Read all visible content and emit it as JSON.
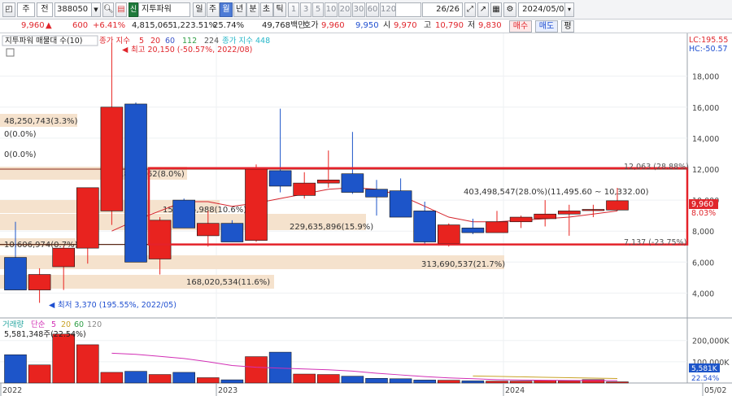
{
  "toolbar": {
    "market": "주",
    "scope": "전",
    "code": "388050",
    "stock_name": "지투파워",
    "period_tabs": [
      "일",
      "주",
      "월",
      "년",
      "분",
      "초",
      "틱"
    ],
    "active_period": "월",
    "intervals": [
      "1",
      "3",
      "5",
      "10",
      "20",
      "30",
      "60",
      "120"
    ],
    "page_indicator": "26/26",
    "date": "2024/05/02"
  },
  "quote": {
    "price": "9,960",
    "change": "600",
    "change_pct": "+6.41%",
    "volume": "4,815,065",
    "volume_ratio": "1,223.51%",
    "turnover_pct": "25.74%",
    "amount": "49,768백만",
    "hoga_label": "호가",
    "hoga_value": "9,960",
    "hoga_value2": "9,950",
    "open_label": "시",
    "open": "9,970",
    "high_label": "고",
    "high": "10,790",
    "low_label": "저",
    "low": "9,830",
    "buy_label": "매수",
    "sell_label": "매도",
    "eval_label": "평"
  },
  "legend": {
    "sector_label": "지투파워 매물대 수(10)",
    "ma_label": "종가 지수",
    "ma_periods": [
      "5",
      "20",
      "60",
      "112",
      "224"
    ],
    "ma_long": "종가 지수 448",
    "lc_label": "LC:195.55",
    "hc_label": "HC:-50.57",
    "volume_label": "거래량",
    "volume_ma_label": "단순",
    "volume_ma_periods": [
      "5",
      "20",
      "60",
      "120"
    ],
    "volume_reading": "5,581,348주(22.54%)"
  },
  "annotations": {
    "high_marker": "최고 20,150 (-50.57%, 2022/08)",
    "low_marker": "최저 3,370 (195.55%, 2022/05)",
    "box_top": "12,063 (28.88%)",
    "box_bottom": "7,137 (-23.75%)",
    "box_range": "403,498,547(28.0%)(11,495.60 ~ 10,332.00)",
    "current_price_label": "9,960",
    "current_pct_label": "8.03%",
    "volume_current_label": "5,581K",
    "volume_pct_label": "22.54%"
  },
  "volume_profile": [
    {
      "label": "48,250,743(3.3%)"
    },
    {
      "label": "0(0.0%)"
    },
    {
      "label": "0(0.0%)"
    },
    {
      "label": "117,803,162(8.0%)"
    },
    {
      "label": "155,255,988(10.6%)"
    },
    {
      "label": "229,635,896(15.9%)"
    },
    {
      "label": "10,606,974(0.7%)"
    },
    {
      "label": "313,690,537(21.7%)"
    },
    {
      "label": "168,020,534(11.6%)"
    }
  ],
  "colors": {
    "up": "#e8231f",
    "down": "#1d55c9",
    "box": "#e4222a",
    "profile": "#f5e2cd",
    "ma": "#d5242c"
  },
  "chart_data": {
    "type": "candlestick",
    "y_axis_ticks": [
      "18,000",
      "16,000",
      "14,000",
      "12,000",
      "10,000",
      "8,000",
      "6,000",
      "4,000"
    ],
    "ylim": [
      2500,
      20500
    ],
    "volume_axis_ticks": [
      "200,000K",
      "100,000K"
    ],
    "volume_ylim": [
      0,
      260000
    ],
    "x_labels": [
      "2022",
      "2023",
      "2024",
      "05/02"
    ],
    "candles": [
      {
        "o": 6300,
        "h": 8600,
        "l": 4200,
        "c": 4200
      },
      {
        "o": 4200,
        "h": 5600,
        "l": 3370,
        "c": 5200
      },
      {
        "o": 5700,
        "h": 7000,
        "l": 4200,
        "c": 6900
      },
      {
        "o": 6900,
        "h": 10800,
        "l": 5900,
        "c": 10800
      },
      {
        "o": 9300,
        "h": 20150,
        "l": 8400,
        "c": 16000
      },
      {
        "o": 16200,
        "h": 16300,
        "l": 6000,
        "c": 6000
      },
      {
        "o": 6200,
        "h": 8900,
        "l": 5200,
        "c": 8700
      },
      {
        "o": 10000,
        "h": 10100,
        "l": 8200,
        "c": 8200
      },
      {
        "o": 7700,
        "h": 9300,
        "l": 7000,
        "c": 8500
      },
      {
        "o": 8500,
        "h": 8700,
        "l": 7300,
        "c": 7300
      },
      {
        "o": 7400,
        "h": 12300,
        "l": 7300,
        "c": 12000
      },
      {
        "o": 11900,
        "h": 15900,
        "l": 10500,
        "c": 10900
      },
      {
        "o": 10300,
        "h": 11800,
        "l": 10100,
        "c": 11100
      },
      {
        "o": 11100,
        "h": 13200,
        "l": 10800,
        "c": 11300
      },
      {
        "o": 11700,
        "h": 14400,
        "l": 10400,
        "c": 10500
      },
      {
        "o": 10700,
        "h": 11300,
        "l": 9000,
        "c": 10200
      },
      {
        "o": 10600,
        "h": 11400,
        "l": 8900,
        "c": 8900
      },
      {
        "o": 9300,
        "h": 9900,
        "l": 7100,
        "c": 7300
      },
      {
        "o": 7200,
        "h": 8500,
        "l": 7000,
        "c": 8400
      },
      {
        "o": 8200,
        "h": 8800,
        "l": 7800,
        "c": 7900
      },
      {
        "o": 7900,
        "h": 9300,
        "l": 7900,
        "c": 8600
      },
      {
        "o": 8600,
        "h": 9000,
        "l": 8200,
        "c": 8900
      },
      {
        "o": 8800,
        "h": 10000,
        "l": 8300,
        "c": 9100
      },
      {
        "o": 9100,
        "h": 9700,
        "l": 7700,
        "c": 9300
      },
      {
        "o": 9400,
        "h": 9700,
        "l": 8900,
        "c": 9400
      },
      {
        "o": 9360,
        "h": 10790,
        "l": 9300,
        "c": 9960
      }
    ],
    "volumes": [
      133000,
      85000,
      230000,
      180000,
      50000,
      55000,
      40000,
      50000,
      25000,
      15000,
      124000,
      145000,
      42000,
      40000,
      32000,
      22000,
      20000,
      14000,
      13000,
      10000,
      9000,
      9000,
      12000,
      10000,
      16000,
      5581
    ],
    "ma20": [
      null,
      null,
      null,
      null,
      8000,
      8700,
      9300,
      9900,
      9900,
      9600,
      9800,
      10100,
      10400,
      10700,
      10800,
      10700,
      10300,
      9600,
      8900,
      8600,
      8600,
      8700,
      8800,
      8900,
      9100,
      9300
    ],
    "volume_ma": [
      null,
      null,
      null,
      null,
      140000,
      135000,
      125000,
      115000,
      100000,
      82000,
      74000,
      70000,
      66000,
      62000,
      56000,
      46000,
      38000,
      30000,
      24000,
      20000,
      16000,
      14000,
      13000,
      12000,
      11500,
      11000
    ],
    "volume_ma_long": [
      null,
      null,
      null,
      null,
      null,
      null,
      null,
      null,
      null,
      null,
      null,
      null,
      null,
      null,
      null,
      null,
      null,
      null,
      null,
      33000,
      31000,
      29000,
      27000,
      25000,
      23000,
      21000
    ],
    "box": {
      "top": 12063,
      "bottom": 7137
    }
  }
}
